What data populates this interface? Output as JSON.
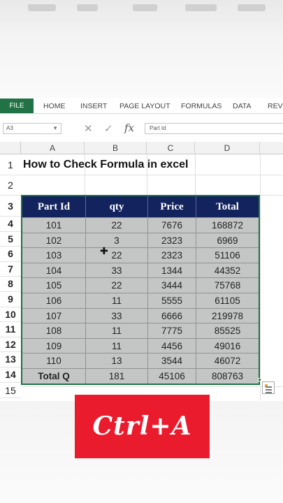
{
  "ribbon": {
    "file_tab": "FILE",
    "tabs": [
      "HOME",
      "INSERT",
      "PAGE LAYOUT",
      "FORMULAS",
      "DATA",
      "REVI"
    ]
  },
  "formula_bar": {
    "name_box": "A3",
    "cancel_icon": "cross-icon",
    "enter_icon": "check-icon",
    "fx_label": "fx",
    "content": "Part Id"
  },
  "sheet": {
    "columns": [
      "A",
      "B",
      "C",
      "D"
    ],
    "rows": [
      "1",
      "2",
      "3",
      "4",
      "5",
      "6",
      "7",
      "8",
      "9",
      "10",
      "11",
      "12",
      "13",
      "14",
      "15"
    ],
    "title": "How to Check Formula in excel",
    "table": {
      "headers": [
        "Part Id",
        "qty",
        "Price",
        "Total"
      ],
      "rows": [
        [
          "101",
          "22",
          "7676",
          "168872"
        ],
        [
          "102",
          "3",
          "2323",
          "6969"
        ],
        [
          "103",
          "22",
          "2323",
          "51106"
        ],
        [
          "104",
          "33",
          "1344",
          "44352"
        ],
        [
          "105",
          "22",
          "3444",
          "75768"
        ],
        [
          "106",
          "11",
          "5555",
          "61105"
        ],
        [
          "107",
          "33",
          "6666",
          "219978"
        ],
        [
          "108",
          "11",
          "7775",
          "85525"
        ],
        [
          "109",
          "11",
          "4456",
          "49016"
        ],
        [
          "110",
          "13",
          "3544",
          "46072"
        ]
      ],
      "total_row": [
        "Total Q",
        "181",
        "45106",
        "808763"
      ]
    },
    "header_color": "#13235e",
    "cell_fill_color": "#c4c6c5",
    "border_color": "#1e7145"
  },
  "overlay": {
    "shortcut_text": "Ctrl+A",
    "shortcut_bg": "#e91b2d"
  }
}
